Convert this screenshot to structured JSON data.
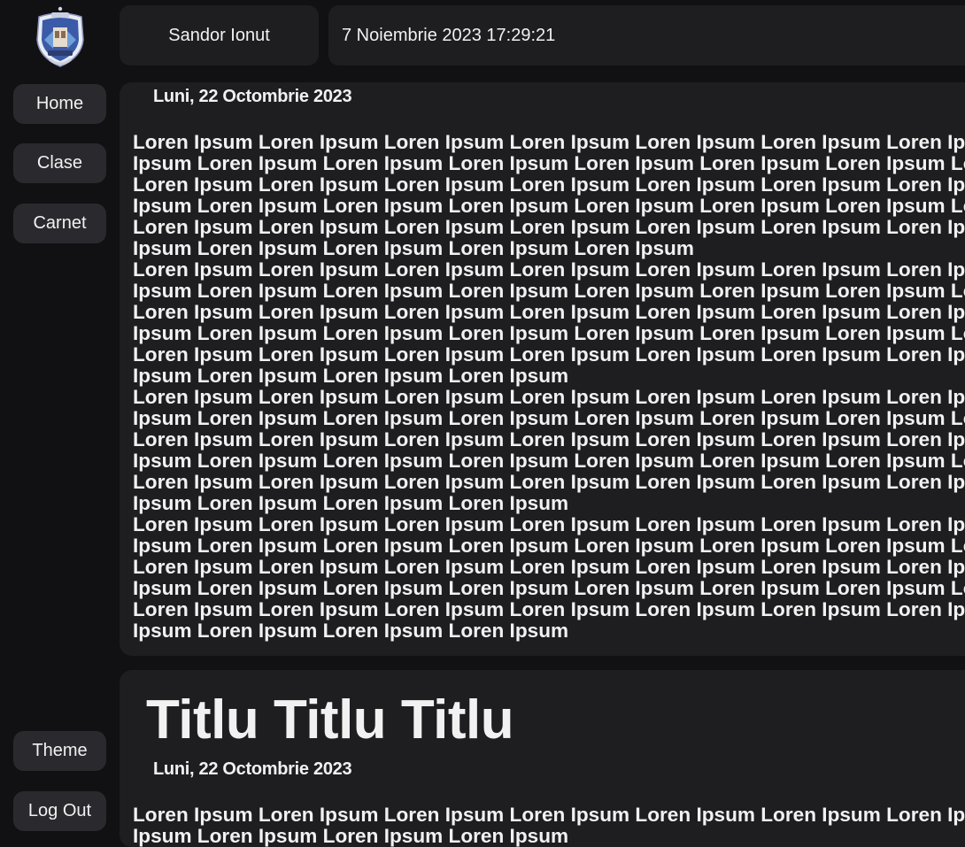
{
  "user": {
    "name": "Sandor Ionut"
  },
  "clock": {
    "datetime": "7 Noiembrie 2023 17:29:21"
  },
  "nav": {
    "home": "Home",
    "clase": "Clase",
    "carnet": "Carnet",
    "theme": "Theme",
    "logout": "Log Out"
  },
  "posts": [
    {
      "title": "",
      "date": "Luni, 22 Octombrie 2023",
      "paragraphs": [
        "Loren Ipsum Loren Ipsum Loren Ipsum Loren Ipsum Loren Ipsum Loren Ipsum Loren Ipsum Loren Ipsum Loren Ipsum Loren Ipsum Loren Ipsum Loren Ipsum Loren Ipsum Loren Ipsum Loren Ipsum Loren Ipsum Loren Ipsum Loren Ipsum Loren Ipsum Loren Ipsum Loren Ipsum Loren Ipsum Loren Ipsum Loren Ipsum Loren Ipsum Loren Ipsum Loren Ipsum Loren Ipsum Loren Ipsum Loren Ipsum Loren Ipsum Loren Ipsum Loren Ipsum Loren Ipsum Loren Ipsum Loren Ipsum Loren Ipsum Loren Ipsum Loren Ipsum Loren Ipsum Loren Ipsum Loren Ipsum Loren Ipsum Loren Ipsum Loren Ipsum Loren Ipsum Loren Ipsum",
        "Loren Ipsum Loren Ipsum Loren Ipsum Loren Ipsum Loren Ipsum Loren Ipsum Loren Ipsum Loren Ipsum Loren Ipsum Loren Ipsum Loren Ipsum Loren Ipsum Loren Ipsum Loren Ipsum Loren Ipsum Loren Ipsum Loren Ipsum Loren Ipsum Loren Ipsum Loren Ipsum Loren Ipsum Loren Ipsum Loren Ipsum Loren Ipsum Loren Ipsum Loren Ipsum Loren Ipsum Loren Ipsum Loren Ipsum Loren Ipsum Loren Ipsum Loren Ipsum Loren Ipsum Loren Ipsum Loren Ipsum Loren Ipsum Loren Ipsum Loren Ipsum Loren Ipsum Loren Ipsum Loren Ipsum Loren Ipsum Loren Ipsum Loren Ipsum Loren Ipsum Loren Ipsum",
        "Loren Ipsum Loren Ipsum Loren Ipsum Loren Ipsum Loren Ipsum Loren Ipsum Loren Ipsum Loren Ipsum Loren Ipsum Loren Ipsum Loren Ipsum Loren Ipsum Loren Ipsum Loren Ipsum Loren Ipsum Loren Ipsum Loren Ipsum Loren Ipsum Loren Ipsum Loren Ipsum Loren Ipsum Loren Ipsum Loren Ipsum Loren Ipsum Loren Ipsum Loren Ipsum Loren Ipsum Loren Ipsum Loren Ipsum Loren Ipsum Loren Ipsum Loren Ipsum Loren Ipsum Loren Ipsum Loren Ipsum Loren Ipsum Loren Ipsum Loren Ipsum Loren Ipsum Loren Ipsum Loren Ipsum Loren Ipsum Loren Ipsum Loren Ipsum Loren Ipsum Loren Ipsum",
        "Loren Ipsum Loren Ipsum Loren Ipsum Loren Ipsum Loren Ipsum Loren Ipsum Loren Ipsum Loren Ipsum Loren Ipsum Loren Ipsum Loren Ipsum Loren Ipsum Loren Ipsum Loren Ipsum Loren Ipsum Loren Ipsum Loren Ipsum Loren Ipsum Loren Ipsum Loren Ipsum Loren Ipsum Loren Ipsum Loren Ipsum Loren Ipsum Loren Ipsum Loren Ipsum Loren Ipsum Loren Ipsum Loren Ipsum Loren Ipsum Loren Ipsum Loren Ipsum Loren Ipsum Loren Ipsum Loren Ipsum Loren Ipsum Loren Ipsum Loren Ipsum Loren Ipsum Loren Ipsum Loren Ipsum Loren Ipsum Loren Ipsum Loren Ipsum Loren Ipsum Loren Ipsum"
      ]
    },
    {
      "title": "Titlu Titlu Titlu",
      "date": "Luni, 22 Octombrie 2023",
      "paragraphs": [
        "Loren Ipsum Loren Ipsum Loren Ipsum Loren Ipsum Loren Ipsum Loren Ipsum Loren Ipsum Loren Ipsum Loren Ipsum Loren Ipsum Loren Ipsum Loren Ipsum"
      ]
    }
  ]
}
